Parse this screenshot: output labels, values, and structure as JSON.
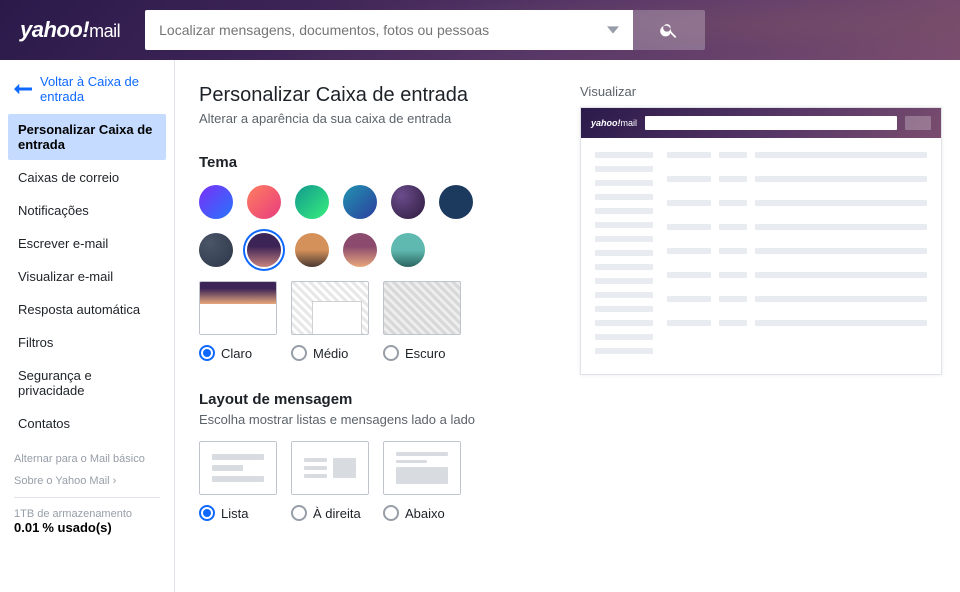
{
  "brand": {
    "bold": "yahoo!",
    "regular": "mail"
  },
  "search": {
    "placeholder": "Localizar mensagens, documentos, fotos ou pessoas"
  },
  "sidebar": {
    "back_label": "Voltar à Caixa de entrada",
    "items": [
      {
        "label": "Personalizar Caixa de entrada",
        "active": true
      },
      {
        "label": "Caixas de correio"
      },
      {
        "label": "Notificações"
      },
      {
        "label": "Escrever e-mail"
      },
      {
        "label": "Visualizar e-mail"
      },
      {
        "label": "Resposta automática"
      },
      {
        "label": "Filtros"
      },
      {
        "label": "Segurança e privacidade"
      },
      {
        "label": "Contatos"
      }
    ],
    "switch_basic": "Alternar para o Mail básico",
    "about": "Sobre o Yahoo Mail",
    "storage_total": "1TB de armazenamento",
    "storage_used_pct": "0.01",
    "storage_used_suffix": "% usado(s)"
  },
  "main": {
    "title": "Personalizar Caixa de entrada",
    "subtitle": "Alterar a aparência da sua caixa de entrada",
    "theme": {
      "heading": "Tema",
      "swatches_row1": [
        "purpleblue",
        "orange",
        "green",
        "teal",
        "darkpurple",
        "navy"
      ],
      "swatches_row2": [
        "slate",
        "dusk",
        "mountain",
        "sunset",
        "ocean"
      ],
      "selected_swatch": "dusk",
      "modes": [
        {
          "key": "claro",
          "label": "Claro"
        },
        {
          "key": "medio",
          "label": "Médio"
        },
        {
          "key": "escuro",
          "label": "Escuro"
        }
      ],
      "selected_mode": "claro"
    },
    "layout": {
      "heading": "Layout de mensagem",
      "subtitle": "Escolha mostrar listas e mensagens lado a lado",
      "options": [
        {
          "key": "lista",
          "label": "Lista"
        },
        {
          "key": "direita",
          "label": "À direita"
        },
        {
          "key": "abaixo",
          "label": "Abaixo"
        }
      ],
      "selected": "lista"
    }
  },
  "preview": {
    "title": "Visualizar"
  }
}
